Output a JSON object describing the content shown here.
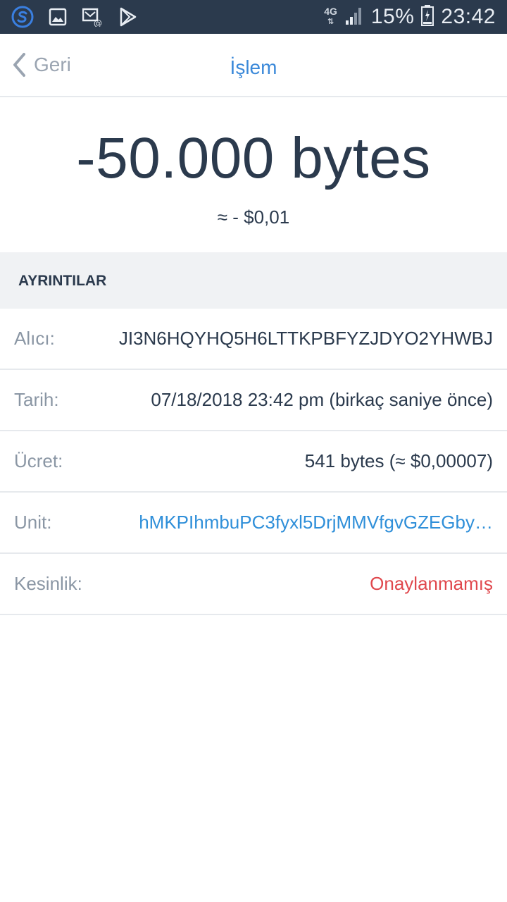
{
  "status_bar": {
    "battery": "15%",
    "time": "23:42",
    "network": "4G",
    "icons": [
      "s-app-icon",
      "gallery-icon",
      "email-icon",
      "play-store-icon",
      "signal-icon",
      "battery-icon"
    ]
  },
  "nav": {
    "back_label": "Geri",
    "title": "İşlem"
  },
  "amount": {
    "value": "-50.000 bytes",
    "fiat": "≈ - $0,01"
  },
  "section": {
    "title": "AYRINTILAR"
  },
  "details": [
    {
      "label": "Alıcı:",
      "value": "JI3N6HQYHQ5H6LTTKPBFYZJDYO2YHWBJ"
    },
    {
      "label": "Tarih:",
      "value": "07/18/2018 23:42 pm (birkaç saniye önce)"
    },
    {
      "label": "Ücret:",
      "value": "541 bytes (≈ $0,00007)"
    },
    {
      "label": "Unit:",
      "value": "hMKPIhmbuPC3fyxl5DrjMMVfgvGZEGby…"
    },
    {
      "label": "Kesinlik:",
      "value": "Onaylanmamış"
    }
  ],
  "colors": {
    "status_bar": "#2b3a4d",
    "accent": "#3b89d9",
    "link": "#2f8fd9",
    "unconfirmed": "#e0484d",
    "text": "#2b3a4d",
    "label": "#8a96a4"
  }
}
